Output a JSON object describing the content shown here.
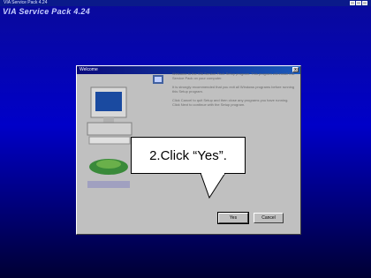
{
  "window": {
    "title": "VIA Service Pack 4.24",
    "banner": "VIA Service Pack 4.24"
  },
  "dialog": {
    "title": "Welcome",
    "paragraphs": [
      "Welcome to the VIA Service Pack Setup program. This program will install VIA Service Pack on your computer.",
      "It is strongly recommended that you exit all Windows programs before running this Setup program.",
      "Click Cancel to quit Setup and then close any programs you have running. Click Next to continue with the Setup program."
    ],
    "buttons": {
      "yes": "Yes",
      "cancel": "Cancel"
    },
    "close_label": "x"
  },
  "callout": {
    "text": "2.Click “Yes”."
  }
}
